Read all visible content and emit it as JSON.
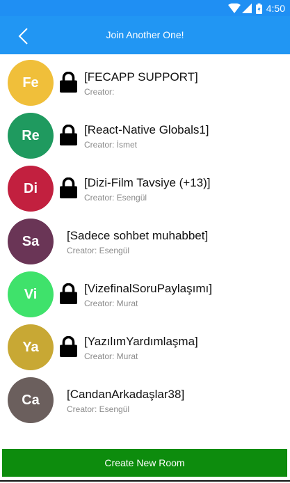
{
  "status_bar": {
    "time": "4:50",
    "icons": [
      "wifi-icon",
      "signal-icon",
      "battery-icon"
    ]
  },
  "header": {
    "title": "Join Another One!",
    "back_icon": "chevron-left-icon"
  },
  "rooms": [
    {
      "initials": "Fe",
      "name": "[FECAPP SUPPORT]",
      "creator": "Creator:",
      "locked": true,
      "color": "#f0bf3a"
    },
    {
      "initials": "Re",
      "name": "[React-Native Globals1]",
      "creator": "Creator: İsmet",
      "locked": true,
      "color": "#1f9a5f"
    },
    {
      "initials": "Di",
      "name": "[Dizi-Film Tavsiye (+13)]",
      "creator": "Creator: Esengül",
      "locked": true,
      "color": "#c2203f"
    },
    {
      "initials": "Sa",
      "name": "[Sadece sohbet muhabbet]",
      "creator": "Creator: Esengül",
      "locked": false,
      "color": "#6a3556"
    },
    {
      "initials": "Vi",
      "name": "[VizefinalSoruPaylaşımı]",
      "creator": "Creator: Murat",
      "locked": true,
      "color": "#3fe26b"
    },
    {
      "initials": "Ya",
      "name": "[YazılımYardımlaşma]",
      "creator": "Creator: Murat",
      "locked": true,
      "color": "#c8a834"
    },
    {
      "initials": "Ca",
      "name": "[CandanArkadaşlar38]",
      "creator": "Creator: Esengül",
      "locked": false,
      "color": "#6b5f5d"
    }
  ],
  "footer": {
    "create_label": "Create New Room"
  },
  "colors": {
    "status_bar": "#1f8ff3",
    "app_bar": "#2196f3",
    "create_button": "#0d8c0d"
  }
}
